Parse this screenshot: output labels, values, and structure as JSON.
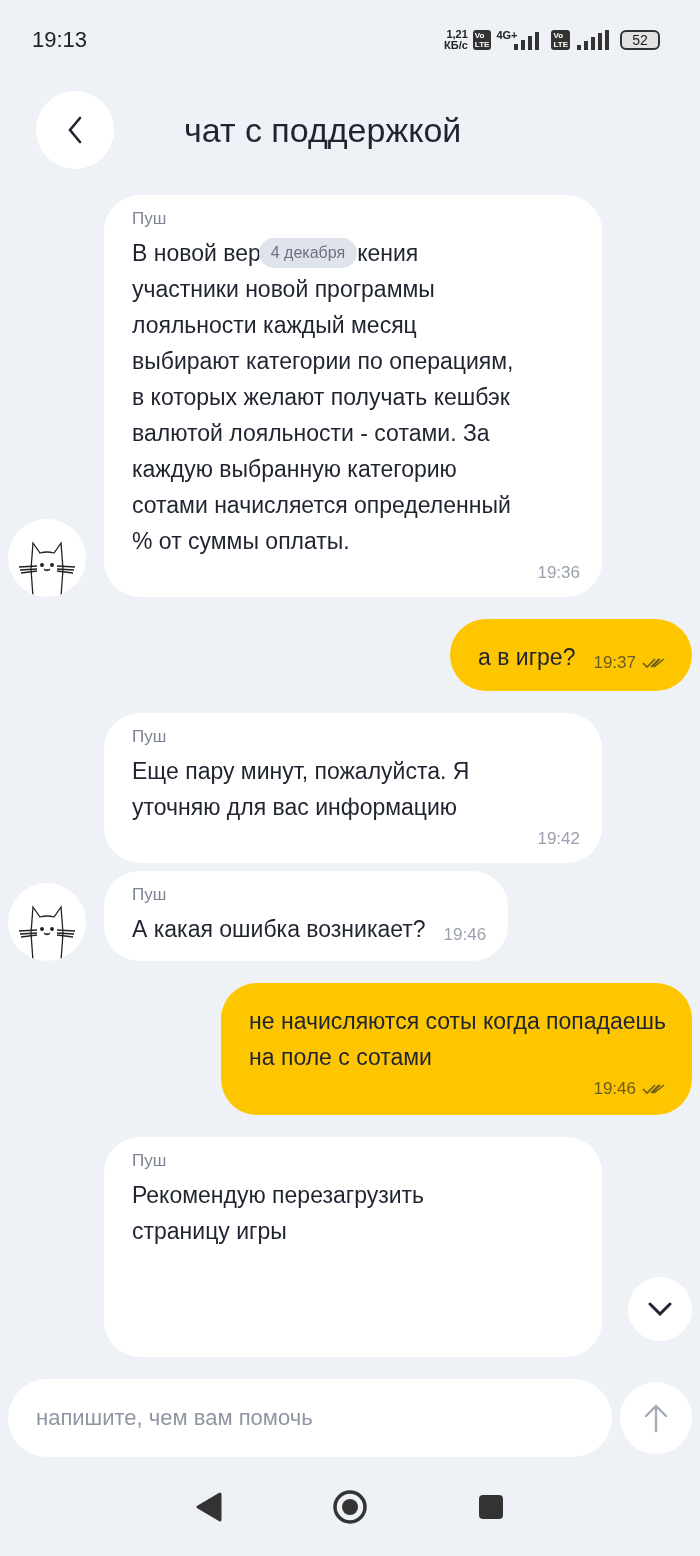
{
  "status_bar": {
    "time": "19:13",
    "speed_value": "1,21",
    "speed_unit": "КБ/с",
    "volte_badges": [
      {
        "top": "Vo",
        "bottom": "LTE"
      },
      {
        "top": "Vo",
        "bottom": "LTE"
      }
    ],
    "network": "4G+",
    "battery": "52"
  },
  "header": {
    "title": "чат с поддержкой"
  },
  "date_pill": "4 декабря",
  "messages": [
    {
      "kind": "incoming",
      "sender": "Пуш",
      "covered_line": [
        "В новой вер",
        "кения"
      ],
      "text": "участники новой программы\nлояльности каждый месяц\nвыбирают категории по операциям,\nв которых желают получать кешбэк\nвалютой лояльности - сотами. За\nкаждую выбранную категорию\nсотами начисляется определенный\n% от суммы оплаты.",
      "time": "19:36",
      "avatar": true
    },
    {
      "kind": "outgoing",
      "text": "а в игре?",
      "time": "19:37",
      "read": true
    },
    {
      "kind": "incoming",
      "sender": "Пуш",
      "text": "Еще пару минут, пожалуйста. Я\nуточняю для вас информацию",
      "time": "19:42",
      "avatar": false
    },
    {
      "kind": "incoming",
      "sender": "Пуш",
      "text": "А какая ошибка возникает?",
      "time": "19:46",
      "avatar": true
    },
    {
      "kind": "outgoing",
      "text": "не начисляются соты когда попадаешь\nна поле с сотами",
      "time": "19:46",
      "read": true
    },
    {
      "kind": "incoming",
      "sender": "Пуш",
      "text": "Рекомендую перезагрузить\nстраницу игры",
      "avatar": false
    }
  ],
  "composer": {
    "placeholder": "напишите, чем вам помочь"
  }
}
